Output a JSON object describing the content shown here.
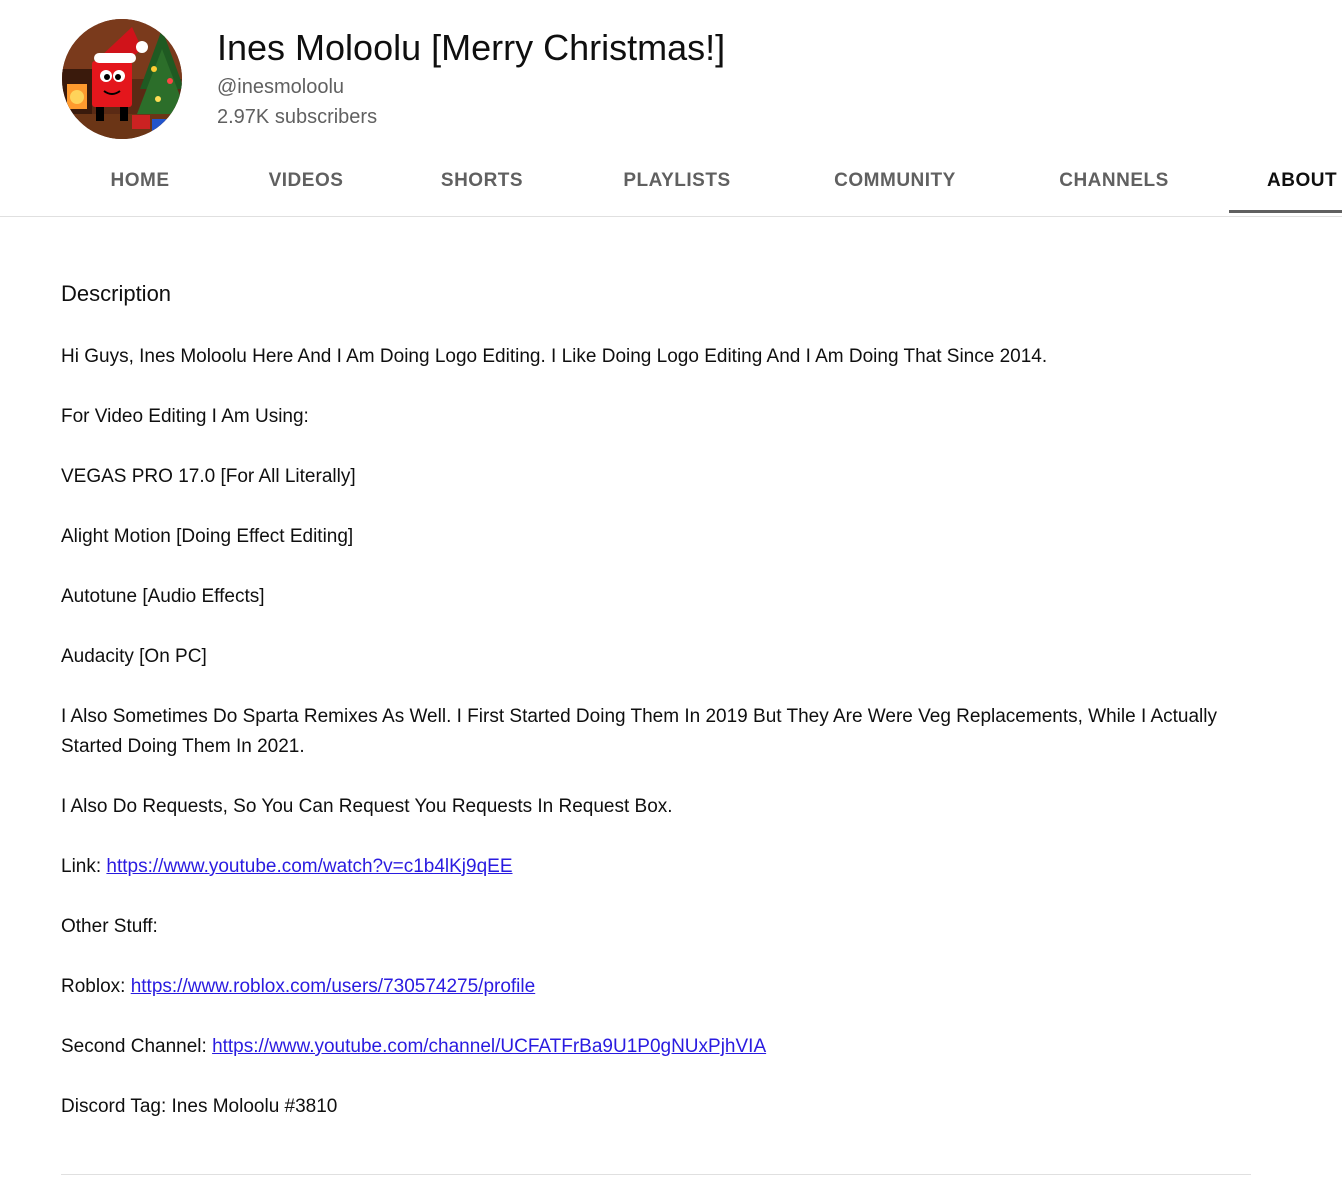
{
  "channel": {
    "title": "Ines Moloolu [Merry Christmas!]",
    "handle": "@inesmoloolu",
    "subscribers": "2.97K subscribers"
  },
  "tabs": [
    {
      "label": "HOME"
    },
    {
      "label": "VIDEOS"
    },
    {
      "label": "SHORTS"
    },
    {
      "label": "PLAYLISTS"
    },
    {
      "label": "COMMUNITY"
    },
    {
      "label": "CHANNELS"
    },
    {
      "label": "ABOUT",
      "active": true
    }
  ],
  "about": {
    "section_title": "Description",
    "paragraphs": [
      "Hi Guys, Ines Moloolu Here And I Am Doing Logo Editing. I Like Doing Logo Editing And I Am Doing That Since 2014.",
      "For Video Editing I Am Using:",
      "VEGAS PRO 17.0 [For All Literally]",
      "Alight Motion [Doing Effect Editing]",
      "Autotune [Audio Effects]",
      "Audacity [On PC]",
      "I Also Sometimes Do Sparta Remixes As Well. I First Started Doing Them In 2019 But They Are Were Veg Replacements, While I Actually Started Doing Them In 2021.",
      "I Also Do Requests, So You Can Request You Requests In Request Box."
    ],
    "request_link_label": "Link: ",
    "request_link": "https://www.youtube.com/watch?v=c1b4lKj9qEE",
    "other_stuff": "Other Stuff:",
    "roblox_label": "Roblox: ",
    "roblox_link": "https://www.roblox.com/users/730574275/profile",
    "second_channel_label": "Second Channel: ",
    "second_channel_link": "https://www.youtube.com/channel/UCFATFrBa9U1P0gNUxPjhVIA",
    "discord": "Discord Tag: Ines Moloolu #3810"
  },
  "colors": {
    "link": "#2a1be0",
    "tab_text": "#606060",
    "active_tab_indicator": "#606060"
  }
}
